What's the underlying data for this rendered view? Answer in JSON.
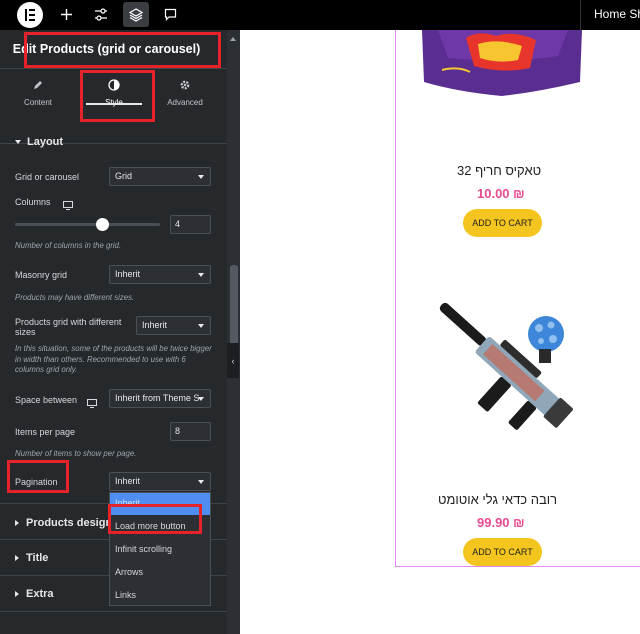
{
  "topbar": {
    "logo_icon": "elementor-logo-icon",
    "buttons": [
      "add-icon",
      "sliders-icon",
      "layers-icon",
      "chat-icon"
    ],
    "home_link": "Home Sho"
  },
  "panel": {
    "title": "Edit Products (grid or carousel)",
    "tabs": [
      {
        "label": "Content",
        "icon": "pencil-icon"
      },
      {
        "label": "Style",
        "icon": "half-circle-icon"
      },
      {
        "label": "Advanced",
        "icon": "gear-icon"
      }
    ],
    "layout_section": {
      "title": "Layout",
      "grid_or_carousel": {
        "label": "Grid or carousel",
        "value": "Grid"
      },
      "columns": {
        "label": "Columns",
        "value": "4",
        "slider_fraction": 0.58,
        "note": "Number of columns in the grid."
      },
      "masonry": {
        "label": "Masonry grid",
        "value": "Inherit",
        "note": "Products may have different sizes."
      },
      "different_sizes": {
        "label": "Products grid with different sizes",
        "value": "Inherit",
        "note": "In this situation, some of the products will be twice bigger in width than others. Recommended to use with 6 columns grid only."
      },
      "space_between": {
        "label": "Space between",
        "value": "Inherit from Theme S"
      },
      "items_per_page": {
        "label": "Items per page",
        "value": "8",
        "note": "Number of items to show per page."
      },
      "pagination": {
        "label": "Pagination",
        "value": "Inherit",
        "options": [
          "Inherit",
          "Load more button",
          "Infinit scrolling",
          "Arrows",
          "Links"
        ]
      }
    },
    "collapsed_sections": [
      "Products design",
      "Title",
      "Extra"
    ]
  },
  "products": [
    {
      "title": "טאקיס חריף 32",
      "price": "10.00 ₪",
      "button": "ADD TO CART"
    },
    {
      "title": "רובה כדאי גלי אוטומט",
      "price": "99.90 ₪",
      "button": "ADD TO CART"
    }
  ],
  "colors": {
    "accent": "#e8498f",
    "button": "#f4c51f",
    "highlight": "#e6232a",
    "panel": "#26292c"
  }
}
